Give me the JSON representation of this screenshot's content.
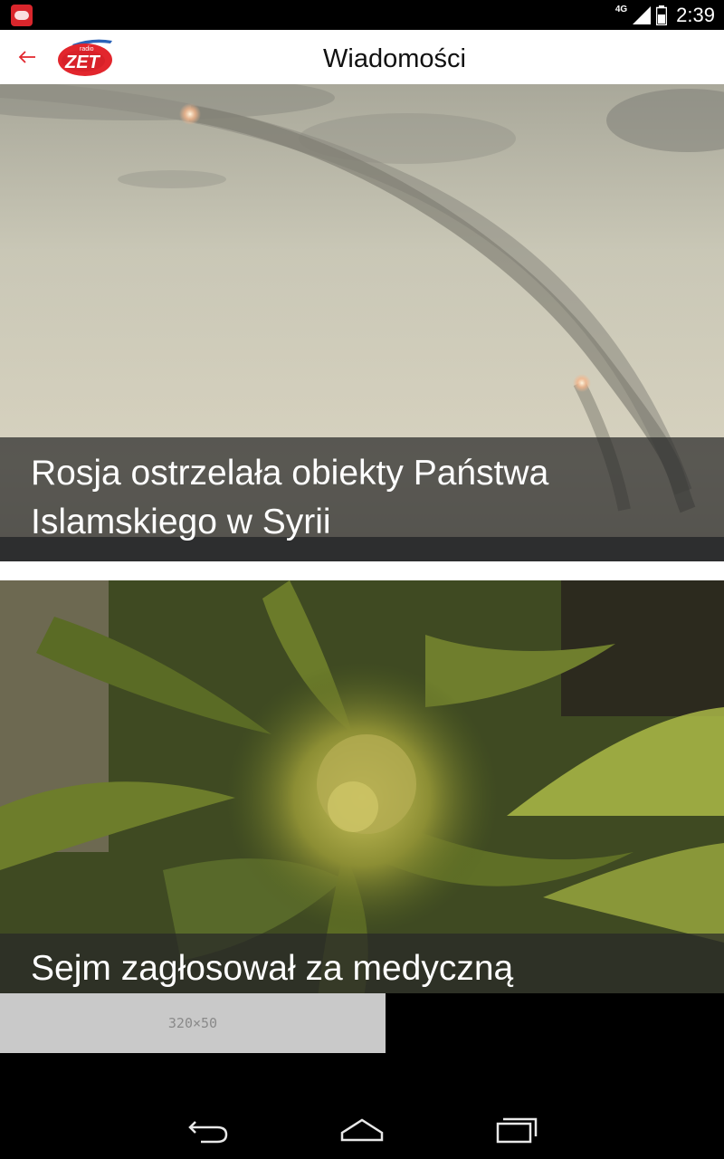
{
  "status_bar": {
    "app_icon": "radio-zet-notification-icon",
    "network": "4G",
    "time": "2:39"
  },
  "app_bar": {
    "back_icon": "back-arrow-icon",
    "logo_text_small": "radio",
    "logo_text": "ZET",
    "title": "Wiadomości",
    "accent_color": "#e2262d"
  },
  "articles": [
    {
      "headline": "Rosja ostrzelała obiekty Państwa Islamskiego w Syrii",
      "image": "missile-launch-photo"
    },
    {
      "headline": "Sejm zagłosował za medyczną",
      "image": "cannabis-plant-photo"
    }
  ],
  "ad": {
    "label": "320×50"
  },
  "nav_bar": {
    "back": "back-icon",
    "home": "home-icon",
    "recents": "recents-icon"
  }
}
